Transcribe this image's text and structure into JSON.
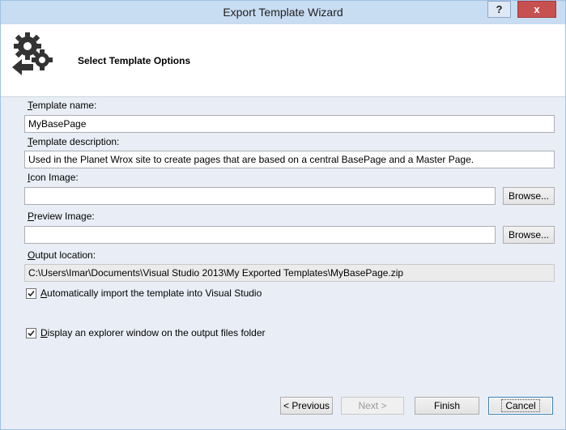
{
  "window": {
    "title": "Export Template Wizard",
    "help_label": "?",
    "close_label": "x"
  },
  "header": {
    "title": "Select Template Options"
  },
  "form": {
    "template_name": {
      "label_u": "T",
      "label_rest": "emplate name:",
      "value": "MyBasePage"
    },
    "template_description": {
      "label_u": "T",
      "label_rest": "emplate description:",
      "value": "Used in the Planet Wrox site to create pages that are based on a central BasePage and a Master Page."
    },
    "icon_image": {
      "label_u": "I",
      "label_rest": "con Image:",
      "value": "",
      "browse_label": "Browse..."
    },
    "preview_image": {
      "label_pre": "P",
      "label_rest": "review Image:",
      "value": "",
      "browse_label": "Browse..."
    },
    "output_location": {
      "label_u": "O",
      "label_rest": "utput location:",
      "value": "C:\\Users\\Imar\\Documents\\Visual Studio 2013\\My Exported Templates\\MyBasePage.zip"
    },
    "auto_import": {
      "checked": true,
      "label_u": "A",
      "label_rest": "utomatically import the template into Visual Studio"
    },
    "display_explorer": {
      "checked": true,
      "label_u": "D",
      "label_rest": "isplay an explorer window on the output files folder"
    }
  },
  "buttons": {
    "previous": "< Previous",
    "next": "Next >",
    "finish": "Finish",
    "cancel": "Cancel"
  },
  "colors": {
    "titlebar": "#c8dcf2",
    "body": "#e9eef6",
    "close": "#c75050"
  }
}
